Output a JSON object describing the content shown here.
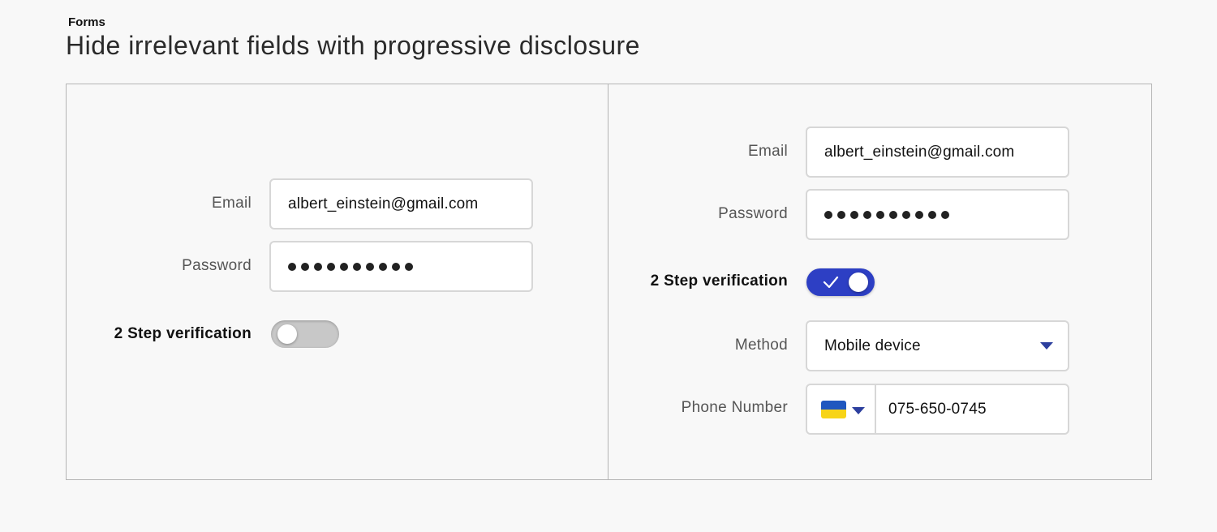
{
  "header": {
    "eyebrow": "Forms",
    "title": "Hide irrelevant fields with progressive disclosure"
  },
  "left_form": {
    "email_label": "Email",
    "email_value": "albert_einstein@gmail.com",
    "password_label": "Password",
    "password_dots": 10,
    "two_step_label": "2 Step verification",
    "two_step_enabled": false
  },
  "right_form": {
    "email_label": "Email",
    "email_value": "albert_einstein@gmail.com",
    "password_label": "Password",
    "password_dots": 10,
    "two_step_label": "2 Step verification",
    "two_step_enabled": true,
    "method_label": "Method",
    "method_value": "Mobile device",
    "phone_label": "Phone Number",
    "phone_country_flag": "ukraine-flag-icon",
    "phone_value": "075-650-0745"
  },
  "colors": {
    "toggle_on": "#2d3fc4",
    "toggle_off": "#c8c8c8",
    "caret": "#2c3f9e",
    "flag_blue": "#1f57bf",
    "flag_yellow": "#f7d417"
  }
}
